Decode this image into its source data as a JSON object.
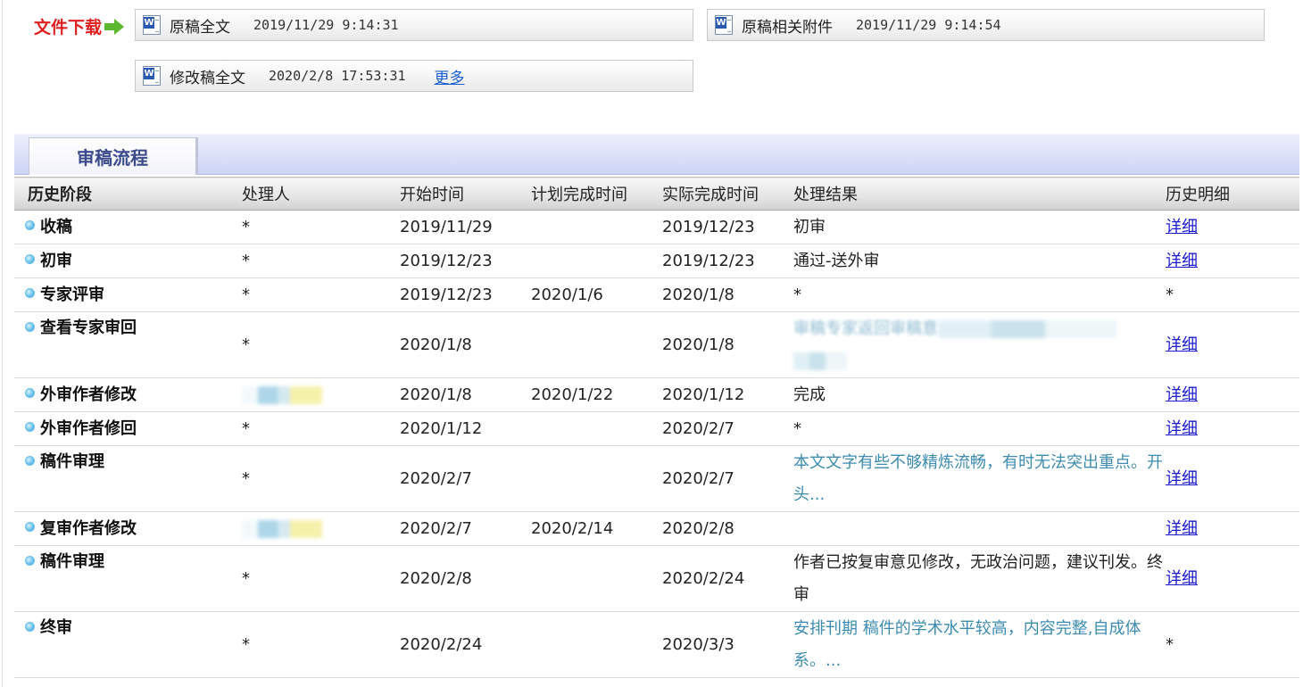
{
  "downloads": {
    "label": "文件下载",
    "files": [
      {
        "name": "原稿全文",
        "time": "2019/11/29 9:14:31"
      },
      {
        "name": "原稿相关附件",
        "time": "2019/11/29 9:14:54"
      },
      {
        "name": "修改稿全文",
        "time": "2020/2/8 17:53:31"
      }
    ],
    "more_label": "更多"
  },
  "tab": {
    "label": "审稿流程"
  },
  "history": {
    "columns": [
      "历史阶段",
      "处理人",
      "开始时间",
      "计划完成时间",
      "实际完成时间",
      "处理结果",
      "历史明细"
    ],
    "rows": [
      {
        "stage": "收稿",
        "handler": "*",
        "start": "2019/11/29",
        "planned": "",
        "actual": "2019/12/23",
        "result": "初审",
        "detail": "详细"
      },
      {
        "stage": "初审",
        "handler": "*",
        "start": "2019/12/23",
        "planned": "",
        "actual": "2019/12/23",
        "result": "通过-送外审",
        "detail": "详细"
      },
      {
        "stage": "专家评审",
        "handler": "*",
        "start": "2019/12/23",
        "planned": "2020/1/6",
        "actual": "2020/1/8",
        "result": "*",
        "detail": "*"
      },
      {
        "stage": "查看专家审回",
        "handler": "*",
        "start": "2020/1/8",
        "planned": "",
        "actual": "2020/1/8",
        "result": "审稿专家返回审稿意",
        "detail": "详细"
      },
      {
        "stage": "外审作者修改",
        "handler": "",
        "start": "2020/1/8",
        "planned": "2020/1/22",
        "actual": "2020/1/12",
        "result": "完成",
        "detail": "详细"
      },
      {
        "stage": "外审作者修回",
        "handler": "*",
        "start": "2020/1/12",
        "planned": "",
        "actual": "2020/2/7",
        "result": "*",
        "detail": "详细"
      },
      {
        "stage": "稿件审理",
        "handler": "*",
        "start": "2020/2/7",
        "planned": "",
        "actual": "2020/2/7",
        "result": "本文文字有些不够精炼流畅，有时无法突出重点。开头...",
        "detail": "详细"
      },
      {
        "stage": "复审作者修改",
        "handler": "",
        "start": "2020/2/7",
        "planned": "2020/2/14",
        "actual": "2020/2/8",
        "result": "",
        "detail": "详细"
      },
      {
        "stage": "稿件审理",
        "handler": "*",
        "start": "2020/2/8",
        "planned": "",
        "actual": "2020/2/24",
        "result": "作者已按复审意见修改，无政治问题，建议刊发。终审",
        "detail": "详细"
      },
      {
        "stage": "终审",
        "handler": "*",
        "start": "2020/2/24",
        "planned": "",
        "actual": "2020/3/3",
        "result": "安排刊期 稿件的学术水平较高，内容完整,自成体系。...",
        "detail": "*"
      }
    ]
  }
}
